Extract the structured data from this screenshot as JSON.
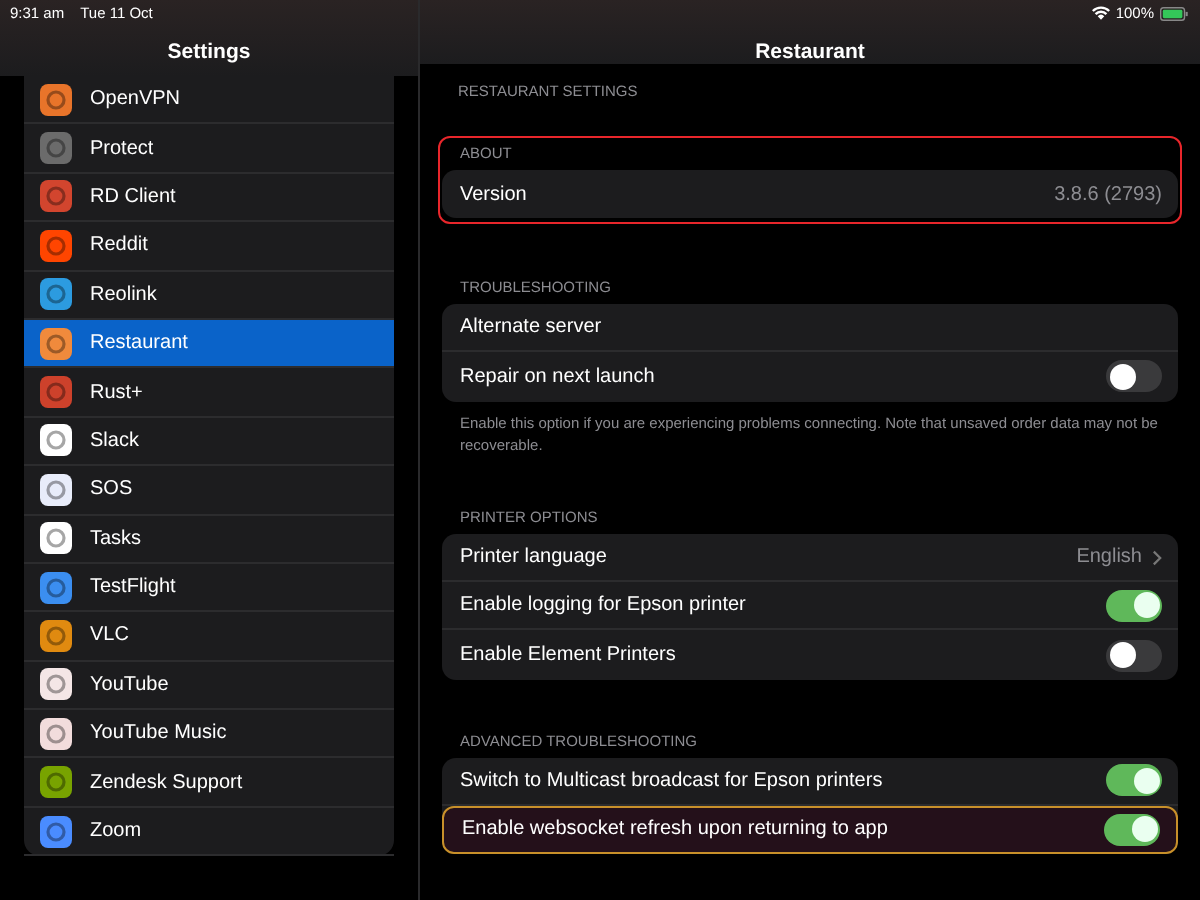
{
  "status_bar": {
    "time": "9:31 am",
    "date": "Tue 11 Oct",
    "battery": "100%"
  },
  "sidebar": {
    "title": "Settings",
    "items": [
      {
        "label": "OpenVPN",
        "color": "#e8742a",
        "selected": false
      },
      {
        "label": "Protect",
        "color": "#6b6b6b",
        "selected": false
      },
      {
        "label": "RD Client",
        "color": "#d2452e",
        "selected": false
      },
      {
        "label": "Reddit",
        "color": "#ff4500",
        "selected": false
      },
      {
        "label": "Reolink",
        "color": "#2c9be0",
        "selected": false
      },
      {
        "label": "Restaurant",
        "color": "#f08a3c",
        "selected": true
      },
      {
        "label": "Rust+",
        "color": "#cd412b",
        "selected": false
      },
      {
        "label": "Slack",
        "color": "#ffffff",
        "selected": false
      },
      {
        "label": "SOS",
        "color": "#e8ecfa",
        "selected": false
      },
      {
        "label": "Tasks",
        "color": "#ffffff",
        "selected": false
      },
      {
        "label": "TestFlight",
        "color": "#3b8ef0",
        "selected": false
      },
      {
        "label": "VLC",
        "color": "#e08a10",
        "selected": false
      },
      {
        "label": "YouTube",
        "color": "#f4e6e6",
        "selected": false
      },
      {
        "label": "YouTube Music",
        "color": "#f2dcdc",
        "selected": false
      },
      {
        "label": "Zendesk Support",
        "color": "#78a300",
        "selected": false
      },
      {
        "label": "Zoom",
        "color": "#4a8cff",
        "selected": false
      }
    ]
  },
  "detail": {
    "title": "Restaurant",
    "page_header": "RESTAURANT SETTINGS",
    "sections": [
      {
        "header": "ABOUT",
        "color": "#e8262b",
        "rows": [
          {
            "kind": "value",
            "label": "Version",
            "value": "3.8.6 (2793)"
          }
        ]
      },
      {
        "header": "TROUBLESHOOTING",
        "rows": [
          {
            "kind": "plain",
            "label": "Alternate server"
          },
          {
            "kind": "toggle",
            "label": "Repair on next launch",
            "on": false
          }
        ],
        "footer": "Enable this option if you are experiencing problems connecting. Note that unsaved order data may not be recoverable."
      },
      {
        "header": "PRINTER OPTIONS",
        "rows": [
          {
            "kind": "link",
            "label": "Printer language",
            "value": "English"
          },
          {
            "kind": "toggle",
            "label": "Enable logging for Epson printer",
            "on": true
          },
          {
            "kind": "toggle",
            "label": "Enable Element Printers",
            "on": false
          }
        ]
      },
      {
        "header": "ADVANCED TROUBLESHOOTING",
        "rows": [
          {
            "kind": "toggle",
            "label": "Switch to Multicast broadcast for Epson printers",
            "on": true
          },
          {
            "kind": "toggle",
            "label": "Enable websocket refresh upon returning to app",
            "on": true,
            "color": "#c8902a"
          }
        ]
      }
    ]
  }
}
